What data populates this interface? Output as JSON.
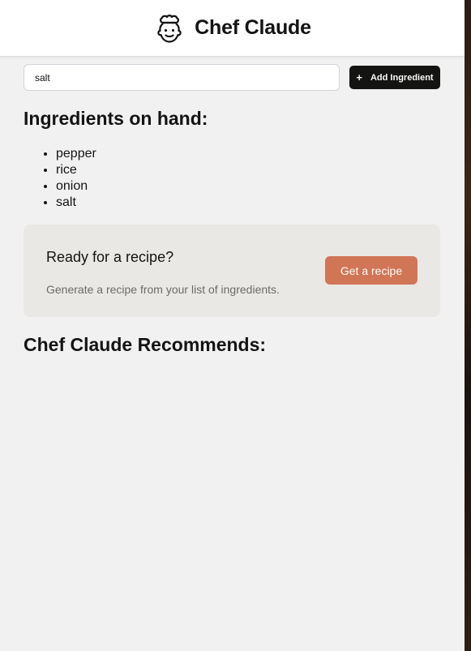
{
  "header": {
    "title": "Chef Claude",
    "logo_icon": "chef-face-icon"
  },
  "form": {
    "input_value": "salt",
    "placeholder": "",
    "add_button_icon": "+",
    "add_button_label": "Add Ingredient"
  },
  "ingredients": {
    "title": "Ingredients on hand:",
    "items": [
      "pepper",
      "rice",
      "onion",
      "salt"
    ]
  },
  "recipe_card": {
    "heading": "Ready for a recipe?",
    "description": "Generate a recipe from your list of ingredients.",
    "button_label": "Get a recipe",
    "button_color": "#d17557"
  },
  "recommends": {
    "title": "Chef Claude Recommends:"
  },
  "colors": {
    "background": "#f1f1f1",
    "header": "#ffffff",
    "primary_button": "#141413",
    "card": "#eae8e4"
  }
}
